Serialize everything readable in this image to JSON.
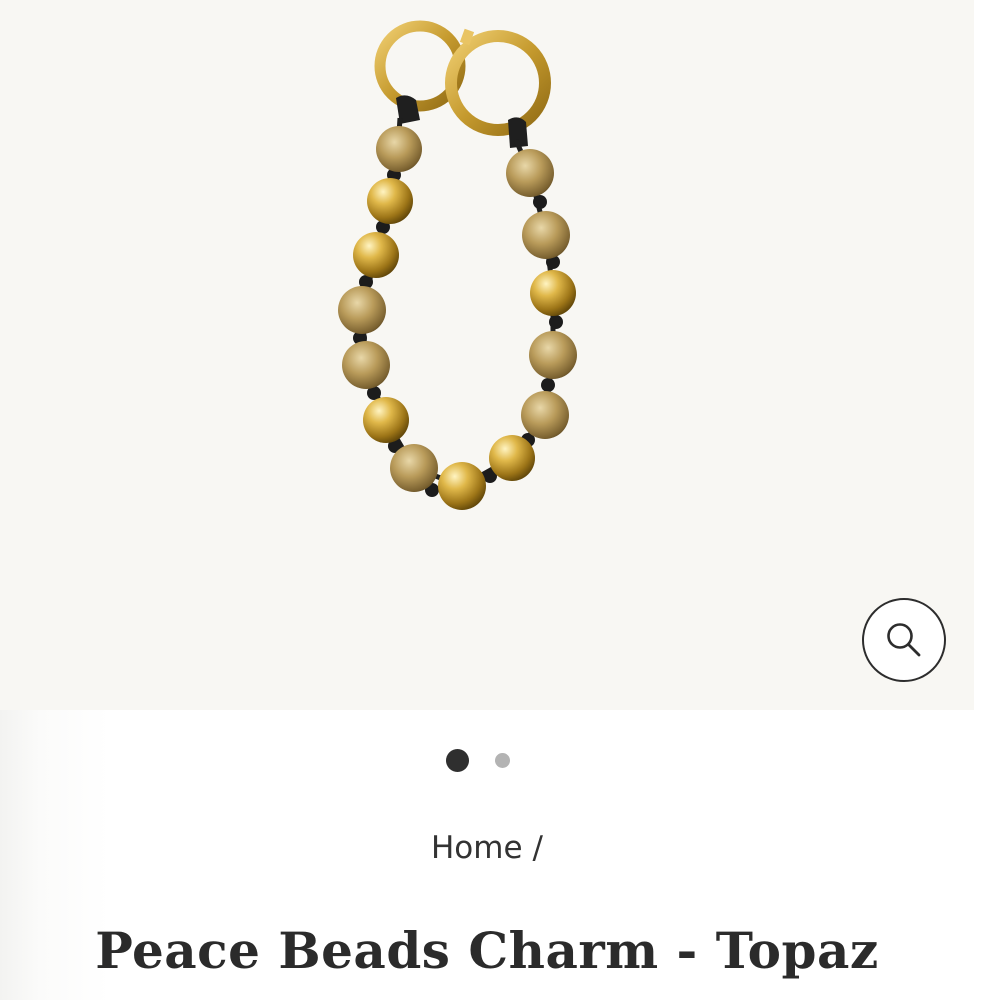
{
  "gallery": {
    "product_image_alt": "Peace Beads Charm - Topaz",
    "zoom_icon": "search-icon",
    "slide_count": 2,
    "active_slide": 1
  },
  "breadcrumb": {
    "home_label": "Home",
    "separator": "/"
  },
  "product": {
    "title": "Peace Beads Charm - Topaz"
  },
  "colors": {
    "gallery_background": "#f8f7f3",
    "gold": "#c9a23a",
    "topaz": "#a88a4a",
    "cord": "#1f1f1f",
    "text": "#2b2b2b",
    "dot_active": "#2f2f2f",
    "dot_inactive": "#b3b3b3"
  }
}
